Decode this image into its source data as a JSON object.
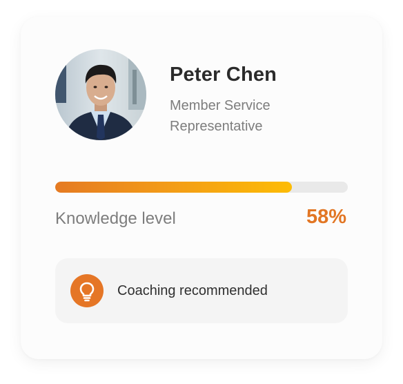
{
  "profile": {
    "name": "Peter Chen",
    "role_line1": "Member Service",
    "role_line2": "Representative",
    "avatar_icon": "person-photo"
  },
  "knowledge": {
    "label": "Knowledge level",
    "value_text": "58%",
    "progress_fraction": 0.81
  },
  "coaching": {
    "icon": "lightbulb-icon",
    "text": "Coaching recommended"
  },
  "colors": {
    "accent": "#e27624",
    "bar_start": "#e57a22",
    "bar_end": "#fdbc05",
    "track": "#e9e9e9"
  }
}
